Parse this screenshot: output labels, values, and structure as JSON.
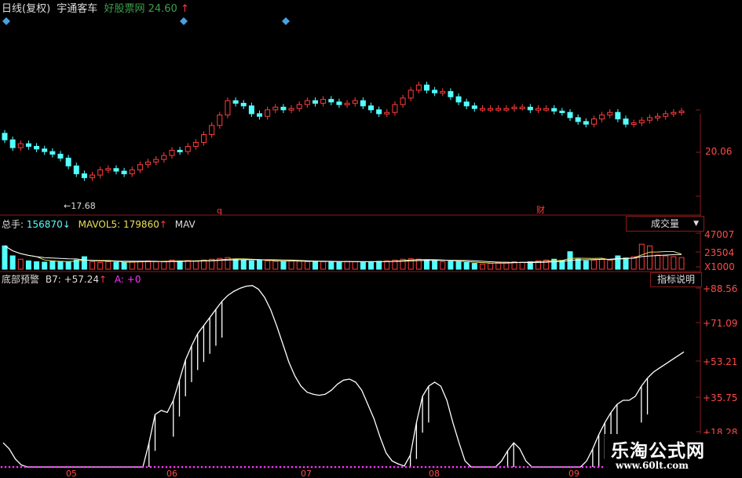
{
  "header": {
    "title": "日线(复权)",
    "stock_name": "宇通客车",
    "source_label": "好股票网",
    "price": "24.60",
    "price_arrow": "↑"
  },
  "price_panel": {
    "y_labels": [
      "20.06"
    ],
    "low_marker": "17.68",
    "event_markers": [
      "q",
      "财"
    ]
  },
  "volume_panel": {
    "total_label": "总手",
    "total_value": "156870",
    "total_arrow": "↓",
    "ma5_label": "MAVOL5",
    "ma5_value": "179860",
    "ma5_arrow": "↑",
    "ma10_label": "MAV",
    "selector_label": "成交量",
    "selector_arrow": "▼",
    "y_labels": [
      "47007",
      "23504",
      "X1000"
    ]
  },
  "indicator_panel": {
    "name": "底部预警",
    "b7_label": "B7",
    "b7_value": "+57.24",
    "b7_arrow": "↑",
    "a_label": "A",
    "a_value": "+0",
    "help_button": "指标说明",
    "y_labels": [
      "+88.56",
      "+71.09",
      "+53.21",
      "+35.75",
      "+18.28"
    ]
  },
  "x_axis": {
    "labels": [
      "05",
      "06",
      "07",
      "08",
      "09"
    ]
  },
  "watermark": {
    "line1": "乐淘公式网",
    "line2": "www.60lt.com"
  },
  "colors": {
    "up": "#ff3c3c",
    "down": "#54ffff",
    "axis": "#8a1a1a",
    "indicator_line": "#ffffff",
    "baseline_dots": "#ff33ff",
    "ma5": "#e8e05a",
    "ma10": "#ffffff"
  },
  "chart_data": [
    {
      "type": "candlestick",
      "title": "宇通客车 日线(复权)",
      "y_labels": [
        "20.06"
      ],
      "annotations": [
        "17.68"
      ],
      "close": [
        21.2,
        20.6,
        20.9,
        20.7,
        20.5,
        20.3,
        20.1,
        19.8,
        19.2,
        18.6,
        18.3,
        18.5,
        18.9,
        19.0,
        18.8,
        18.6,
        18.9,
        19.3,
        19.5,
        19.7,
        20.0,
        20.4,
        20.3,
        20.7,
        21.0,
        21.6,
        22.3,
        23.1,
        24.2,
        24.0,
        23.8,
        23.2,
        23.0,
        23.5,
        23.7,
        23.5,
        23.6,
        23.9,
        24.2,
        24.0,
        24.3,
        24.1,
        23.9,
        24.0,
        24.2,
        23.8,
        23.5,
        23.2,
        23.3,
        23.9,
        24.4,
        25.0,
        25.4,
        25.0,
        24.8,
        24.9,
        24.5,
        24.1,
        23.8,
        23.6,
        23.6,
        23.6,
        23.6,
        23.6,
        23.7,
        23.7,
        23.5,
        23.6,
        23.6,
        23.4,
        23.3,
        22.9,
        22.6,
        22.4,
        22.8,
        23.1,
        23.3,
        22.8,
        22.4,
        22.5,
        22.7,
        22.9,
        23.0,
        23.2,
        23.3,
        23.4
      ],
      "volume_scale": "X1000",
      "volume_ticks": [
        47007,
        23504
      ],
      "volume": [
        28000,
        16000,
        12000,
        10000,
        9000,
        8500,
        10000,
        9500,
        9000,
        11000,
        15000,
        9000,
        8000,
        9000,
        8500,
        8000,
        9000,
        9500,
        10000,
        9000,
        9500,
        11000,
        10000,
        10500,
        9500,
        11000,
        12000,
        13000,
        14000,
        12000,
        11000,
        10000,
        10500,
        10000,
        9500,
        9000,
        10000,
        9500,
        9000,
        9500,
        9000,
        8500,
        9000,
        9500,
        9000,
        8500,
        9000,
        9500,
        10000,
        11000,
        12000,
        12500,
        12000,
        11000,
        10500,
        9000,
        9500,
        9000,
        8000,
        7000,
        6000,
        7000,
        8000,
        8500,
        9000,
        8500,
        9000,
        10000,
        11000,
        12000,
        10500,
        21000,
        12000,
        10000,
        11000,
        12000,
        11000,
        16000,
        13500,
        15000,
        30000,
        28000,
        17000,
        16000,
        15000,
        14000
      ]
    },
    {
      "type": "line",
      "title": "底部预警",
      "series_name": "B7",
      "last_value": 57.24,
      "ylim": [
        0,
        88.56
      ],
      "y_ticks": [
        88.56,
        71.09,
        53.21,
        35.75,
        18.28
      ],
      "x_labels": [
        "05",
        "06",
        "07",
        "08",
        "09"
      ],
      "values": [
        12,
        9,
        4,
        1,
        0,
        0,
        0,
        0,
        0,
        0,
        0,
        0,
        0,
        0,
        0,
        0,
        0,
        0,
        0,
        0,
        0,
        0,
        0,
        0,
        12,
        26,
        28,
        27,
        33,
        43,
        53,
        60,
        66,
        70,
        74,
        78,
        82,
        85,
        87,
        88.5,
        89.5,
        89.8,
        88,
        84,
        78,
        70,
        61,
        52,
        45,
        40,
        37,
        36,
        35.5,
        36,
        38,
        41,
        43,
        43.5,
        42,
        38,
        31,
        24,
        15,
        7,
        3,
        1.5,
        0.5,
        6,
        22,
        35,
        40,
        42,
        40,
        33,
        22,
        12,
        3,
        0,
        0,
        0,
        0,
        0,
        3,
        8,
        12,
        9,
        3,
        0,
        0,
        0,
        0,
        0,
        0,
        0,
        0,
        0,
        3,
        9,
        16,
        22,
        27,
        31,
        33,
        33,
        35,
        40,
        44,
        47,
        49,
        51,
        53,
        55,
        57
      ]
    }
  ]
}
